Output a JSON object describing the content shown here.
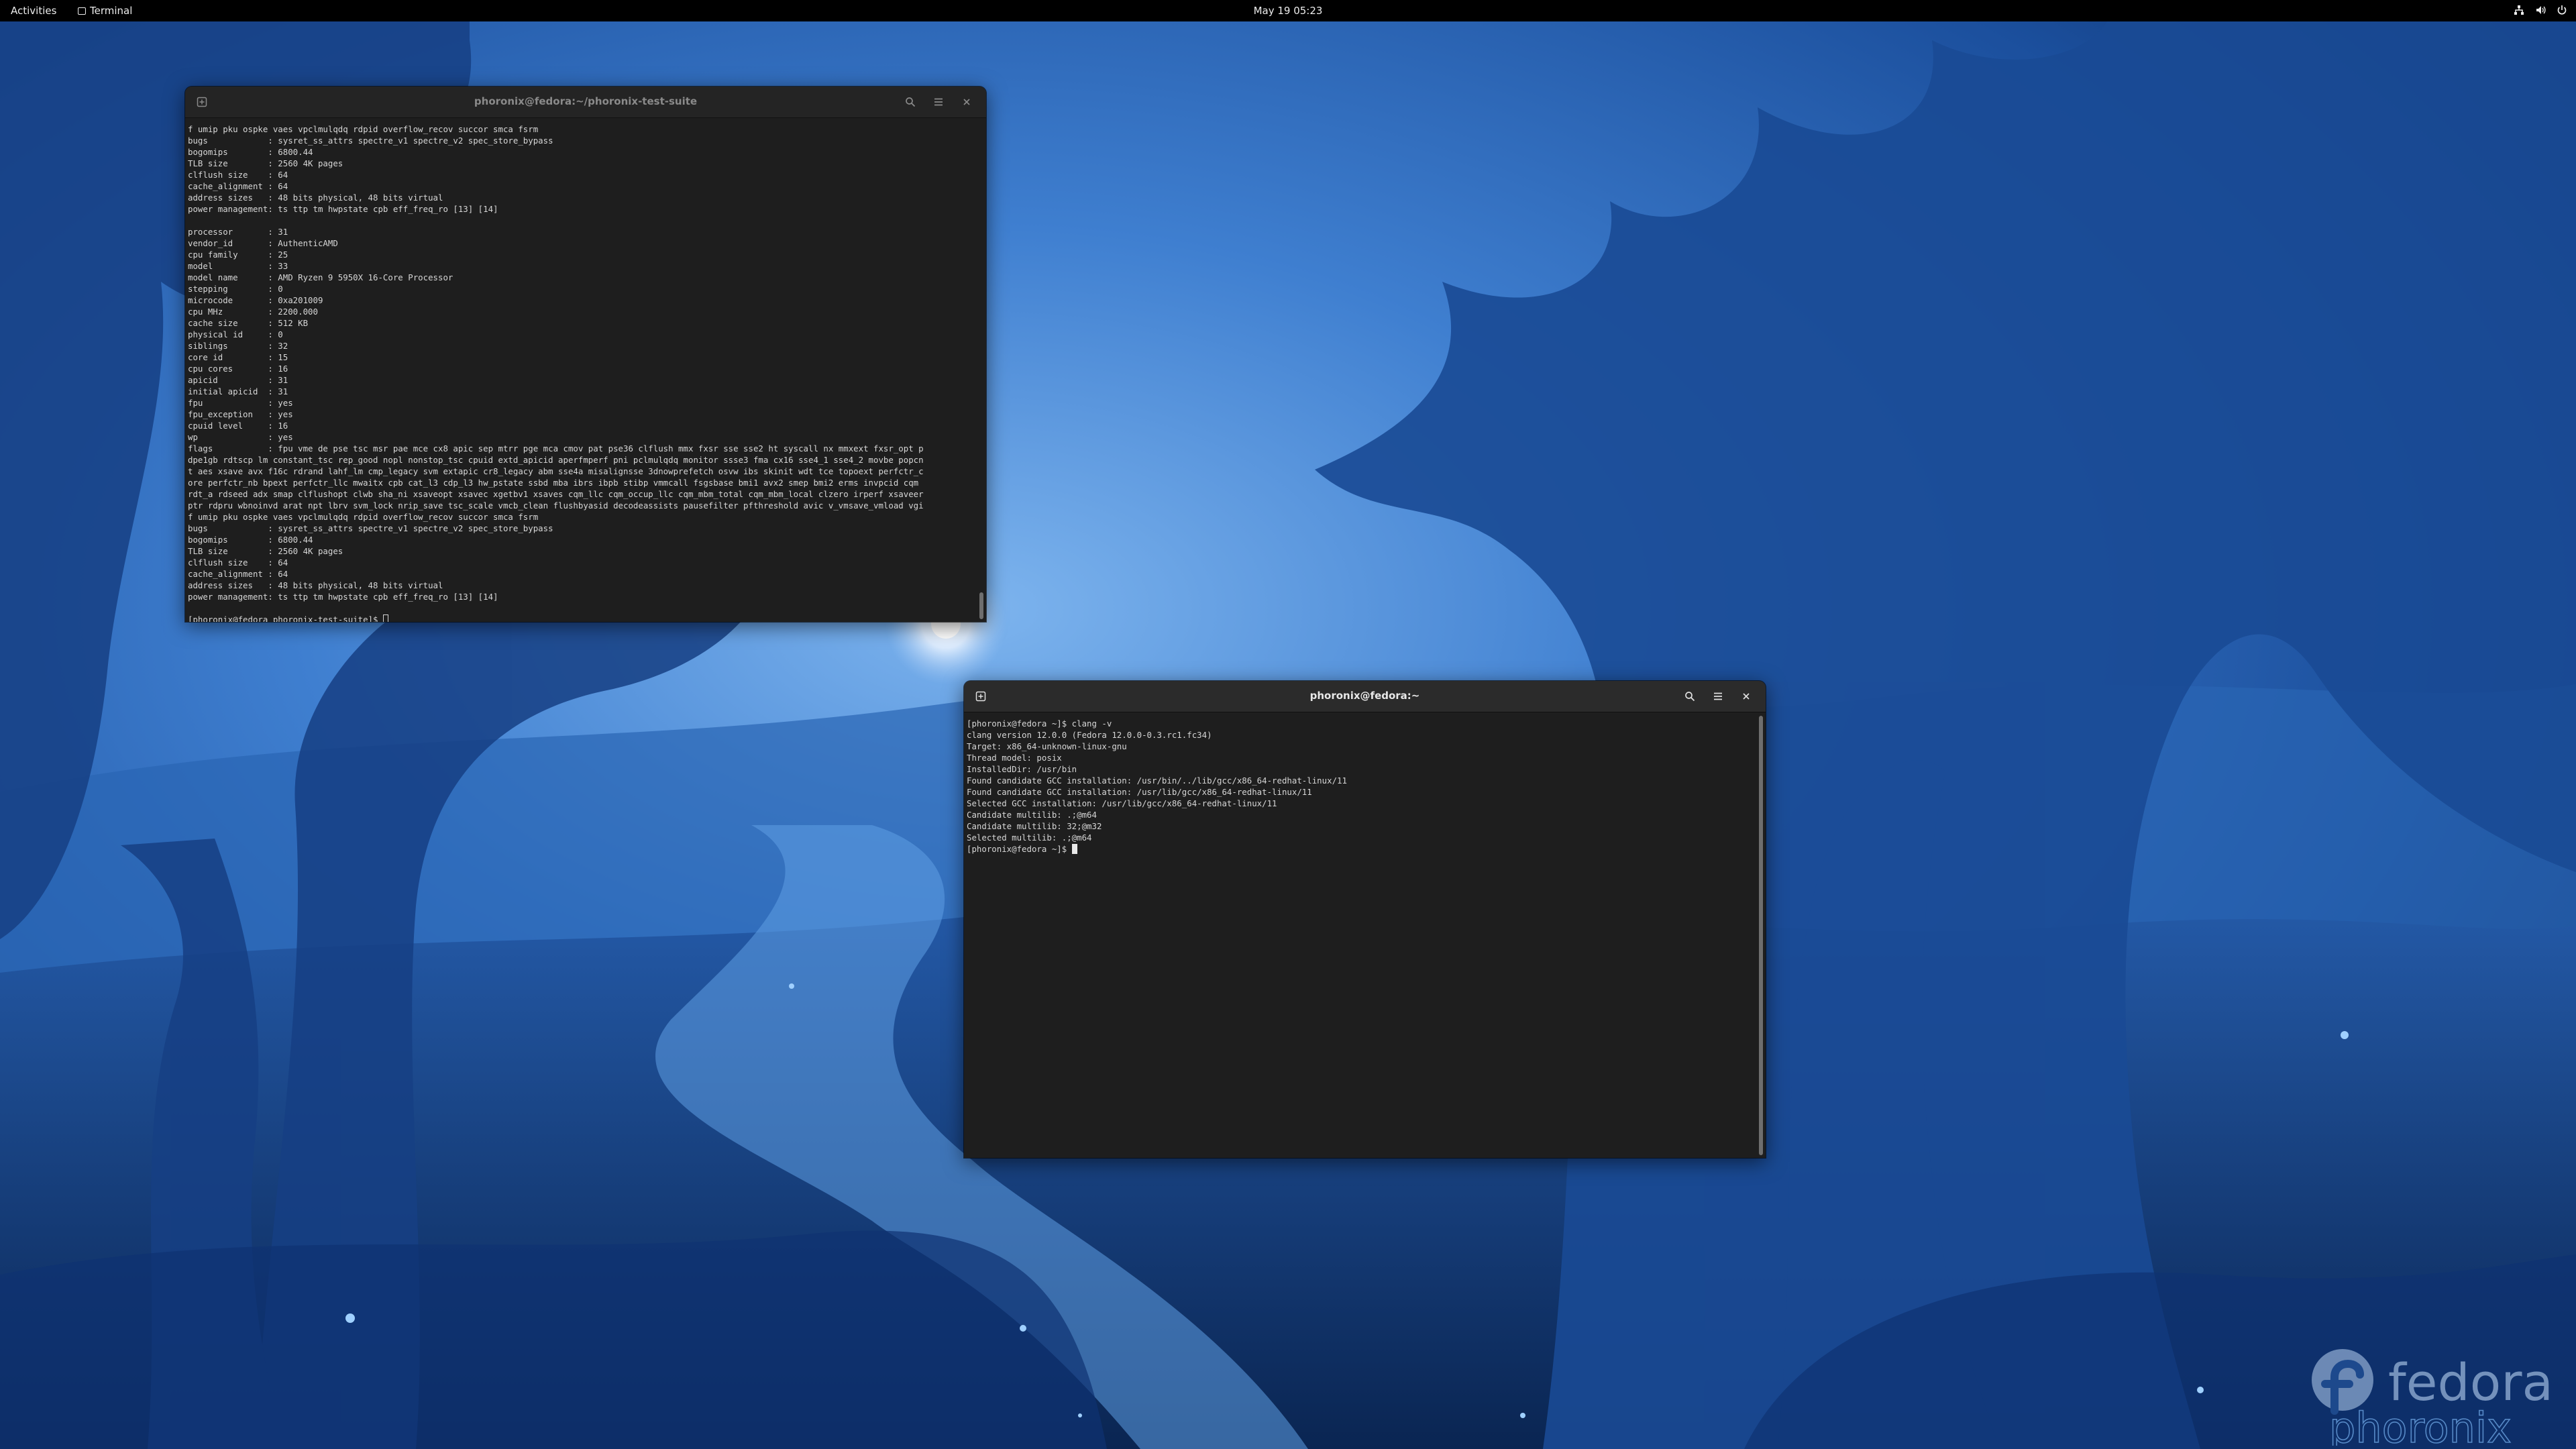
{
  "topbar": {
    "activities": "Activities",
    "app_name": "Terminal",
    "clock": "May 19  05:23"
  },
  "windows": {
    "top": {
      "title": "phoronix@fedora:~/phoronix-test-suite",
      "lines": [
        "f umip pku ospke vaes vpclmulqdq rdpid overflow_recov succor smca fsrm",
        "bugs            : sysret_ss_attrs spectre_v1 spectre_v2 spec_store_bypass",
        "bogomips        : 6800.44",
        "TLB size        : 2560 4K pages",
        "clflush size    : 64",
        "cache_alignment : 64",
        "address sizes   : 48 bits physical, 48 bits virtual",
        "power management: ts ttp tm hwpstate cpb eff_freq_ro [13] [14]",
        "",
        "processor       : 31",
        "vendor_id       : AuthenticAMD",
        "cpu family      : 25",
        "model           : 33",
        "model name      : AMD Ryzen 9 5950X 16-Core Processor",
        "stepping        : 0",
        "microcode       : 0xa201009",
        "cpu MHz         : 2200.000",
        "cache size      : 512 KB",
        "physical id     : 0",
        "siblings        : 32",
        "core id         : 15",
        "cpu cores       : 16",
        "apicid          : 31",
        "initial apicid  : 31",
        "fpu             : yes",
        "fpu_exception   : yes",
        "cpuid level     : 16",
        "wp              : yes",
        "flags           : fpu vme de pse tsc msr pae mce cx8 apic sep mtrr pge mca cmov pat pse36 clflush mmx fxsr sse sse2 ht syscall nx mmxext fxsr_opt p",
        "dpe1gb rdtscp lm constant_tsc rep_good nopl nonstop_tsc cpuid extd_apicid aperfmperf pni pclmulqdq monitor ssse3 fma cx16 sse4_1 sse4_2 movbe popcn",
        "t aes xsave avx f16c rdrand lahf_lm cmp_legacy svm extapic cr8_legacy abm sse4a misalignsse 3dnowprefetch osvw ibs skinit wdt tce topoext perfctr_c",
        "ore perfctr_nb bpext perfctr_llc mwaitx cpb cat_l3 cdp_l3 hw_pstate ssbd mba ibrs ibpb stibp vmmcall fsgsbase bmi1 avx2 smep bmi2 erms invpcid cqm",
        "rdt_a rdseed adx smap clflushopt clwb sha_ni xsaveopt xsavec xgetbv1 xsaves cqm_llc cqm_occup_llc cqm_mbm_total cqm_mbm_local clzero irperf xsaveer",
        "ptr rdpru wbnoinvd arat npt lbrv svm_lock nrip_save tsc_scale vmcb_clean flushbyasid decodeassists pausefilter pfthreshold avic v_vmsave_vmload vgi",
        "f umip pku ospke vaes vpclmulqdq rdpid overflow_recov succor smca fsrm",
        "bugs            : sysret_ss_attrs spectre_v1 spectre_v2 spec_store_bypass",
        "bogomips        : 6800.44",
        "TLB size        : 2560 4K pages",
        "clflush size    : 64",
        "cache_alignment : 64",
        "address sizes   : 48 bits physical, 48 bits virtual",
        "power management: ts ttp tm hwpstate cpb eff_freq_ro [13] [14]",
        ""
      ],
      "prompt": "[phoronix@fedora phoronix-test-suite]$ "
    },
    "bottom": {
      "title": "phoronix@fedora:~",
      "lines": [
        "[phoronix@fedora ~]$ clang -v",
        "clang version 12.0.0 (Fedora 12.0.0-0.3.rc1.fc34)",
        "Target: x86_64-unknown-linux-gnu",
        "Thread model: posix",
        "InstalledDir: /usr/bin",
        "Found candidate GCC installation: /usr/bin/../lib/gcc/x86_64-redhat-linux/11",
        "Found candidate GCC installation: /usr/lib/gcc/x86_64-redhat-linux/11",
        "Selected GCC installation: /usr/lib/gcc/x86_64-redhat-linux/11",
        "Candidate multilib: .;@m64",
        "Candidate multilib: 32;@m32",
        "Selected multilib: .;@m64"
      ],
      "prompt": "[phoronix@fedora ~]$ "
    }
  },
  "watermark": {
    "fedora": "fedora",
    "phoronix": "phoronix"
  },
  "colors": {
    "wallpaper_dark": "#0b2a5e",
    "wallpaper_mid": "#2f6fc0",
    "wallpaper_light": "#6aa8e8",
    "terminal_bg": "#1e1e1e",
    "titlebar_bg": "#2b2b2b"
  },
  "icons": {
    "new_tab": "new-tab-icon",
    "search": "search-icon",
    "menu": "hamburger-menu-icon",
    "close": "close-icon",
    "network": "network-icon",
    "volume": "volume-icon",
    "power": "power-icon"
  }
}
